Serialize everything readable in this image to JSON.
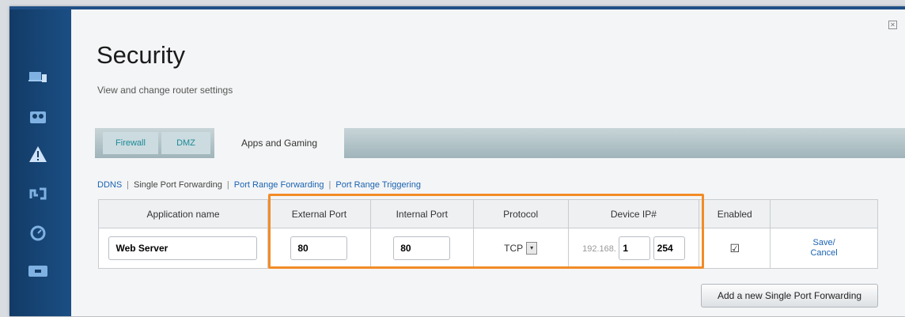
{
  "page": {
    "title": "Security",
    "subtitle": "View and change router settings"
  },
  "sidebar": {
    "icons": [
      "devices-icon",
      "parental-controls-icon",
      "warning-icon",
      "bandwidth-icon",
      "speed-test-icon",
      "external-storage-icon"
    ]
  },
  "tabs": [
    {
      "label": "Firewall"
    },
    {
      "label": "DMZ"
    },
    {
      "label": "Apps and Gaming"
    }
  ],
  "subnav": [
    "DDNS",
    "Single Port Forwarding",
    "Port Range Forwarding",
    "Port Range Triggering"
  ],
  "table": {
    "headers": [
      "Application name",
      "External Port",
      "Internal Port",
      "Protocol",
      "Device IP#",
      "Enabled",
      ""
    ],
    "row": {
      "app_name": "Web Server",
      "external_port": "80",
      "internal_port": "80",
      "protocol": "TCP",
      "ip_prefix": "192.168.",
      "ip_octet3": "1",
      "ip_octet4": "254",
      "enabled": true,
      "save_label": "Save/",
      "cancel_label": "Cancel"
    }
  },
  "buttons": {
    "add_label": "Add a new Single Port Forwarding"
  },
  "colors": {
    "sidebar": "#1b4e84",
    "highlight": "#f28c28",
    "link": "#1a63b2",
    "tab_teal": "#1c8a99"
  }
}
